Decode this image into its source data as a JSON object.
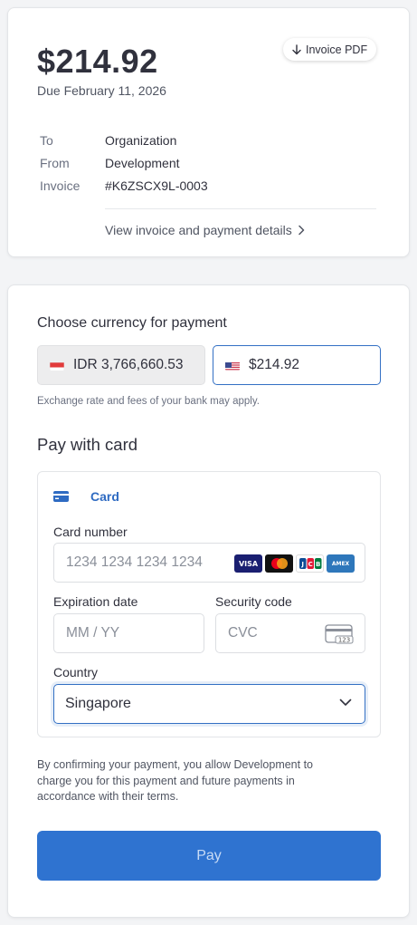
{
  "invoice": {
    "amount": "$214.92",
    "due": "Due February 11, 2026",
    "pdf_button": "Invoice PDF",
    "rows": [
      {
        "label": "To",
        "value": "Organization"
      },
      {
        "label": "From",
        "value": "Development"
      },
      {
        "label": "Invoice",
        "value": "#K6ZSCX9L-0003"
      }
    ],
    "view_link": "View invoice and payment details"
  },
  "payment": {
    "currency_title": "Choose currency for payment",
    "currencies": [
      {
        "label": "IDR 3,766,660.53",
        "flag": "indonesia-flag-icon",
        "selected": false
      },
      {
        "label": "$214.92",
        "flag": "us-flag-icon",
        "selected": true
      }
    ],
    "note": "Exchange rate and fees of your bank may apply.",
    "card_title": "Pay with card",
    "card_tab": "Card",
    "card_number_label": "Card number",
    "card_number_placeholder": "1234 1234 1234 1234",
    "brands": [
      "VISA",
      "Mastercard",
      "JCB",
      "AMEX"
    ],
    "expiry_label": "Expiration date",
    "expiry_placeholder": "MM / YY",
    "cvc_label": "Security code",
    "cvc_placeholder": "CVC",
    "cvc_icon_text": "123",
    "country_label": "Country",
    "country_value": "Singapore",
    "consent": "By confirming your payment, you allow Development to charge you for this payment and future payments in accordance with their terms.",
    "pay_button": "Pay"
  },
  "colors": {
    "accent": "#2f73d0",
    "focus_border": "#3370c4"
  }
}
